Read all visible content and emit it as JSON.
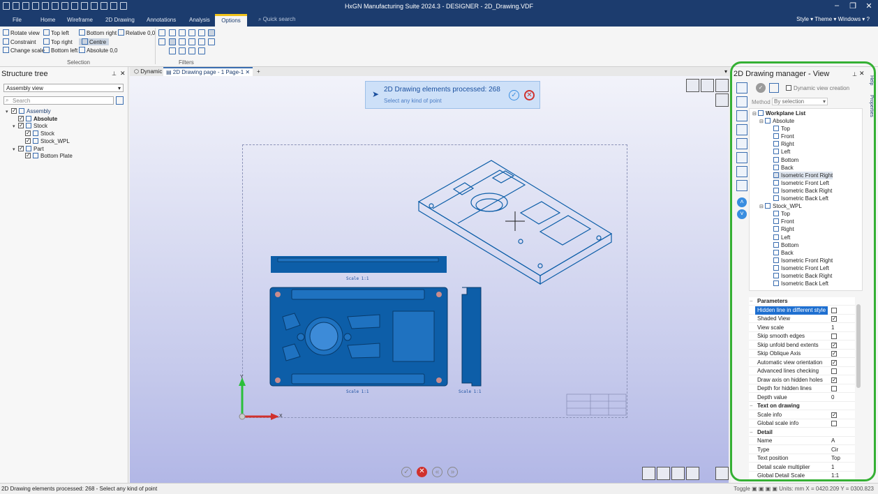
{
  "title": "HxGN Manufacturing Suite 2024.3 - DESIGNER - 2D_Drawing.VDF",
  "menu_tabs": [
    "File",
    "Home",
    "Wireframe",
    "2D Drawing",
    "Annotations",
    "Analysis",
    "Options"
  ],
  "active_tab": "Options",
  "quick_search": "Quick search",
  "right_menu": "Style  ▾ Theme  ▾ Windows  ▾",
  "ribbon": {
    "items": [
      "Rotate view",
      "Constraint",
      "Change scale",
      "Top left",
      "Top right",
      "Bottom left",
      "Bottom right",
      "Centre",
      "Absolute 0,0",
      "Relative 0,0"
    ],
    "group_selection": "Selection",
    "group_filters": "Filters"
  },
  "structure_tree": {
    "title": "Structure tree",
    "view_combo": "Assembly view",
    "search_placeholder": "Search",
    "items": [
      {
        "label": "Assembly",
        "indent": 0,
        "bold": false,
        "blue": true
      },
      {
        "label": "Absolute",
        "indent": 1,
        "bold": true,
        "blue": false
      },
      {
        "label": "Stock",
        "indent": 1,
        "bold": false,
        "blue": false
      },
      {
        "label": "Stock",
        "indent": 2,
        "bold": false,
        "blue": false
      },
      {
        "label": "Stock_WPL",
        "indent": 2,
        "bold": false,
        "blue": false
      },
      {
        "label": "Part",
        "indent": 1,
        "bold": false,
        "blue": false
      },
      {
        "label": "Bottom Plate",
        "indent": 2,
        "bold": false,
        "blue": false
      }
    ]
  },
  "doc_tabs": [
    "Dynamic",
    "2D Drawing page - 1 Page-1"
  ],
  "message": {
    "line1": "2D Drawing elements processed: 268",
    "line2": "Select any kind of point"
  },
  "drawing": {
    "scale_label": "Scale  1:1",
    "axis_x": "X",
    "axis_y": "Y"
  },
  "manager": {
    "title": "2D Drawing manager - View",
    "dynamic_label": "Dynamic view creation",
    "method_label": "Method",
    "method_value": "By selection",
    "workplane_root": "Workplane List",
    "groups": [
      {
        "name": "Absolute",
        "views": [
          "Top",
          "Front",
          "Right",
          "Left",
          "Bottom",
          "Back",
          "Isometric Front Right",
          "Isometric Front Left",
          "Isometric Back Right",
          "Isometric Back Left"
        ]
      },
      {
        "name": "Stock_WPL",
        "views": [
          "Top",
          "Front",
          "Right",
          "Left",
          "Bottom",
          "Back",
          "Isometric Front Right",
          "Isometric Front Left",
          "Isometric Back Right",
          "Isometric Back Left"
        ]
      }
    ],
    "highlighted_view": "Isometric Front Right",
    "side_tabs": [
      "Help",
      "Properties"
    ]
  },
  "parameters": {
    "sections": [
      {
        "name": "Parameters",
        "rows": [
          {
            "k": "Hidden line in different style",
            "cb": false,
            "hl": true
          },
          {
            "k": "Shaded View",
            "cb": true
          },
          {
            "k": "View scale",
            "v": "1"
          },
          {
            "k": "Skip smooth edges",
            "cb": false
          },
          {
            "k": "Skip unfold bend extents",
            "cb": true
          },
          {
            "k": "Skip Oblique Axis",
            "cb": true
          },
          {
            "k": "Automatic view orientation",
            "cb": true
          },
          {
            "k": "Advanced lines checking",
            "cb": false
          },
          {
            "k": "Draw axis on hidden holes",
            "cb": true
          },
          {
            "k": "Depth for hidden lines",
            "cb": false
          },
          {
            "k": "Depth value",
            "v": "0"
          }
        ]
      },
      {
        "name": "Text on drawing",
        "rows": [
          {
            "k": "Scale info",
            "cb": true
          },
          {
            "k": "Global scale info",
            "cb": false
          }
        ]
      },
      {
        "name": "Detail",
        "rows": [
          {
            "k": "Name",
            "v": "A"
          },
          {
            "k": "Type",
            "v": "Cir"
          },
          {
            "k": "Text position",
            "v": "Top"
          },
          {
            "k": "Detail scale multiplier",
            "v": "1"
          },
          {
            "k": "Global Detail Scale",
            "v": "1:1"
          }
        ]
      }
    ]
  },
  "status": {
    "left": "2D Drawing elements processed: 268 - Select any kind of point",
    "toggle": "Toggle",
    "units": "Units: mm  X = 0420.209  Y = 0300.823"
  },
  "colors": {
    "accent": "#1c3c6e",
    "drawing_blue": "#0d5ea8",
    "highlight": "#f0c21a",
    "frame": "#35b034"
  }
}
